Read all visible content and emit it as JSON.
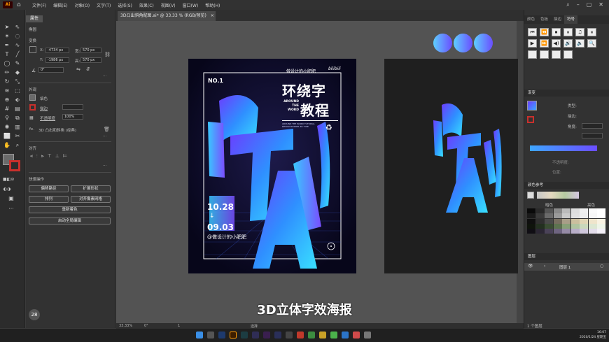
{
  "menubar": {
    "logo": "Ai",
    "items": [
      "文件(F)",
      "编辑(E)",
      "对象(O)",
      "文字(T)",
      "选择(S)",
      "效果(C)",
      "视图(V)",
      "窗口(W)",
      "帮助(H)"
    ]
  },
  "document_tab": {
    "title": "3D凸出斜角配图.ai* @ 33.33 % (RGB/预览)",
    "close": "×"
  },
  "properties": {
    "tab": "属性",
    "section_object": "椭圆",
    "section_transform": "变换",
    "x_label": "X:",
    "x_value": "-4734 px",
    "y_label": "Y:",
    "y_value": "-1986 px",
    "w_label": "宽:",
    "w_value": "570 px",
    "h_label": "高:",
    "h_value": "570 px",
    "angle_value": "0°",
    "section_appearance": "外观",
    "fill_label": "填色",
    "stroke_label": "描边",
    "opacity_label": "不透明度",
    "opacity_value": "100%",
    "effect_label": "3D 凸出和斜角 (经典)",
    "fx": "fx.",
    "section_align": "对齐",
    "section_quick": "快速操作",
    "btn_offset": "偏移路径",
    "btn_expand": "扩展形状",
    "btn_arrange": "排列",
    "btn_pixel": "对齐像素网格",
    "btn_recolor": "重新着色",
    "btn_global": "启动全局编辑"
  },
  "poster": {
    "no": "NO.1",
    "author_top": "做设计的小肥肥",
    "bilibili": "bilibili",
    "title_line1": "环绕字",
    "title_line2": "教程",
    "around1": "AROUND",
    "around2": "THE",
    "around3": "WORD",
    "small_text": "AROUND THE WORD TUTORIAL DESIGN POSTER 3D TYPE",
    "date1": "10.28",
    "arrow": "↓",
    "date2": "09.03",
    "author_bottom": "@做设计的小肥肥",
    "big_letters": "RTAI"
  },
  "subtitle": "3D立体字效海报",
  "right_panel": {
    "tabs1": [
      "颜色",
      "色板",
      "描边",
      "符号"
    ],
    "symbols": [
      "⏮",
      "⏪",
      "⏹",
      "⏸",
      "♫",
      "⏸",
      "⏹",
      "▶",
      "⏩",
      "◀)",
      "🔊",
      "🔈",
      "🔍",
      "📍"
    ],
    "gradient_title": "渐变",
    "gradient_type": "类型:",
    "gradient_stroke": "描边:",
    "gradient_angle": "角度:",
    "gradient_opacity": "不透明度:",
    "gradient_pos": "位置:",
    "guide_title": "颜色参考",
    "guide_dark": "暗色",
    "guide_light": "亮色",
    "layers_title": "图层",
    "layer_name": "图层 1",
    "layer_count": "1 个图层"
  },
  "statusbar": {
    "zoom": "33.33%",
    "angle": "0°",
    "page": "1",
    "tool": "选择"
  },
  "taskbar": {
    "time": "16:07",
    "date": "2020/1/24 星期五"
  },
  "colors": {
    "accent_blue": "#3ea6ff",
    "accent_purple": "#6b4dff",
    "ai_orange": "#ff9a00"
  }
}
